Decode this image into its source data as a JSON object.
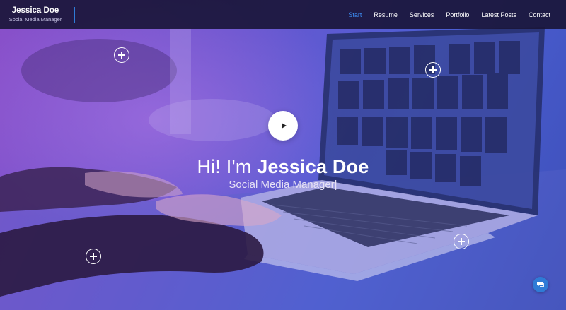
{
  "brand": {
    "name": "Jessica Doe",
    "role": "Social Media Manager"
  },
  "nav": {
    "items": [
      "Start",
      "Resume",
      "Services",
      "Portfolio",
      "Latest Posts",
      "Contact"
    ],
    "active": "Start"
  },
  "hero": {
    "greeting": "Hi! I'm ",
    "name": "Jessica Doe",
    "subtitle": "Social Media Manager",
    "cursor": "|"
  },
  "icons": {
    "play": "play-icon",
    "plus": "plus-icon",
    "chat": "chat-icon"
  },
  "colors": {
    "accent": "#3d8ef5",
    "nav_bg": "#1a163a",
    "chat_bg": "#2f7bd6"
  }
}
